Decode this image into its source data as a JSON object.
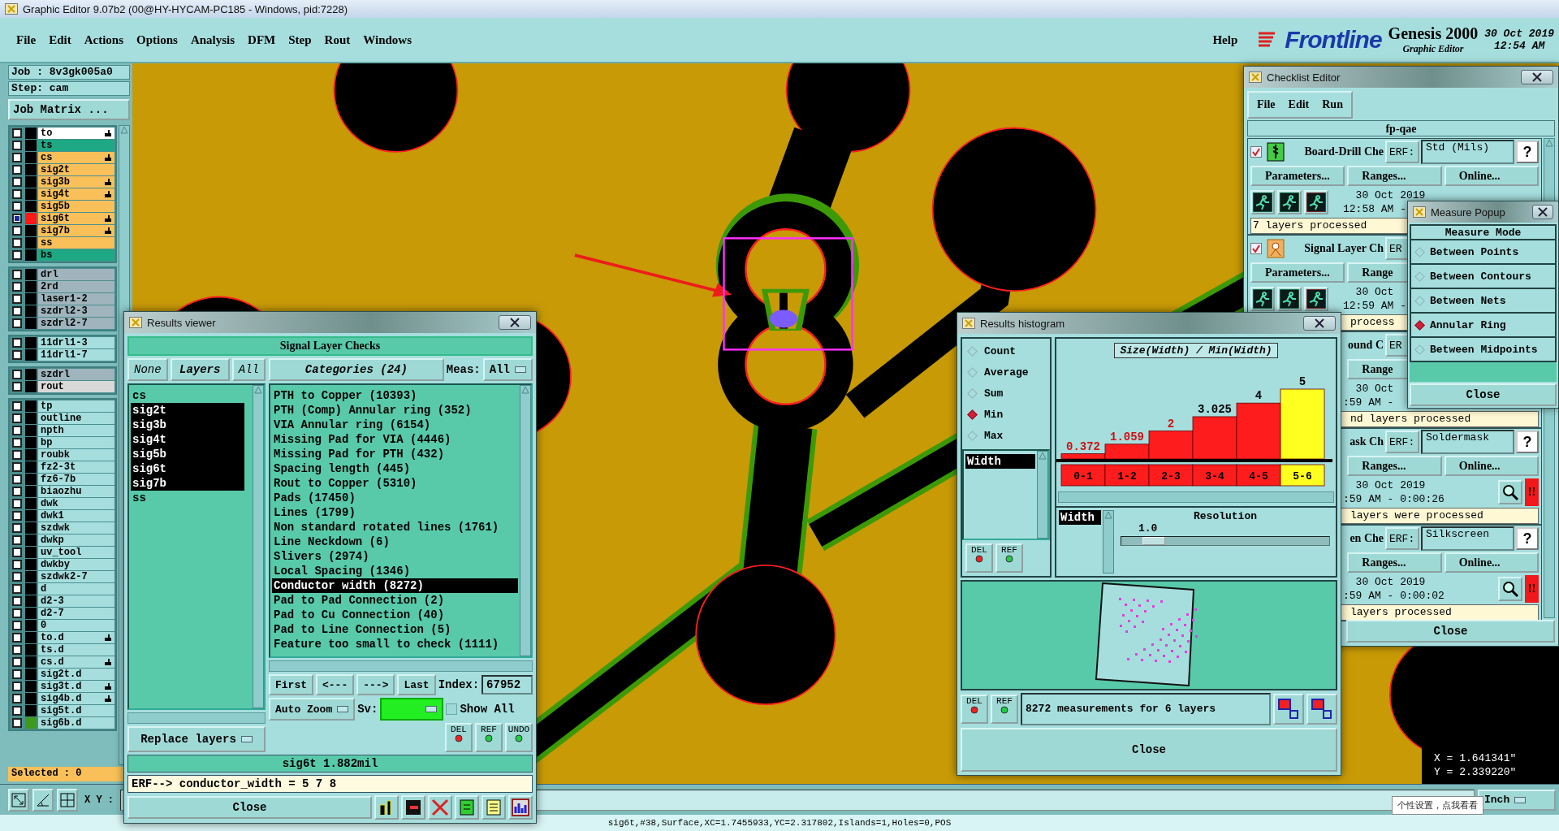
{
  "app": {
    "title": "Graphic Editor 9.07b2 (00@HY-HYCAM-PC185 - Windows, pid:7228)",
    "menu": [
      "File",
      "Edit",
      "Actions",
      "Options",
      "Analysis",
      "DFM",
      "Step",
      "Rout",
      "Windows"
    ],
    "help": "Help",
    "brand": {
      "logo": "Frontline",
      "product": "Genesis 2000",
      "subtitle": "Graphic Editor",
      "date": "30 Oct 2019",
      "time": "12:54 AM"
    }
  },
  "job_panel": {
    "job": "Job : 8v3gk005a0",
    "step": "Step: cam",
    "matrix_button": "Job Matrix ...",
    "layer_groups": [
      {
        "layers": [
          {
            "name": "to",
            "kind": "plain",
            "color": "#ffffff",
            "checked": false,
            "affected": true
          },
          {
            "name": "ts",
            "kind": "plain",
            "color": "#1ea884",
            "checked": false,
            "affected": false
          },
          {
            "name": "cs",
            "kind": "plain",
            "color": "#f9c05a",
            "checked": false,
            "affected": true
          },
          {
            "name": "sig2t",
            "kind": "plain",
            "color": "#f9c05a",
            "checked": false,
            "affected": false
          },
          {
            "name": "sig3b",
            "kind": "plain",
            "color": "#f9c05a",
            "checked": false,
            "affected": true
          },
          {
            "name": "sig4t",
            "kind": "plain",
            "color": "#f9c05a",
            "checked": false,
            "affected": true
          },
          {
            "name": "sig5b",
            "kind": "plain",
            "color": "#f9c05a",
            "checked": false,
            "affected": false
          },
          {
            "name": "sig6t",
            "kind": "work",
            "color": "#f9c05a",
            "checked": true,
            "affected": true
          },
          {
            "name": "sig7b",
            "kind": "plain",
            "color": "#f9c05a",
            "checked": false,
            "affected": true
          },
          {
            "name": "ss",
            "kind": "plain",
            "color": "#f9c05a",
            "checked": false,
            "affected": false
          },
          {
            "name": "bs",
            "kind": "plain",
            "color": "#1ea884",
            "checked": false,
            "affected": false
          }
        ]
      },
      {
        "layers": [
          {
            "name": "drl",
            "kind": "plain",
            "color": "#9fb4bc",
            "checked": false,
            "affected": false
          },
          {
            "name": "2rd",
            "kind": "plain",
            "color": "#9fb4bc",
            "checked": false,
            "affected": false
          },
          {
            "name": "laser1-2",
            "kind": "plain",
            "color": "#9fb4bc",
            "checked": false,
            "affected": false
          },
          {
            "name": "szdrl2-3",
            "kind": "plain",
            "color": "#9fb4bc",
            "checked": false,
            "affected": false
          },
          {
            "name": "szdrl2-7",
            "kind": "plain",
            "color": "#9fb4bc",
            "checked": false,
            "affected": false
          }
        ]
      },
      {
        "layers": [
          {
            "name": "11drl1-3",
            "kind": "plain",
            "color": "#a6dede",
            "checked": false,
            "affected": false
          },
          {
            "name": "11drl1-7",
            "kind": "plain",
            "color": "#a6dede",
            "checked": false,
            "affected": false
          }
        ]
      },
      {
        "layers": [
          {
            "name": "szdrl",
            "kind": "plain",
            "color": "#9fb4bc",
            "checked": false,
            "affected": false
          },
          {
            "name": "rout",
            "kind": "plain",
            "color": "#d9d9d9",
            "checked": false,
            "affected": false
          }
        ]
      },
      {
        "layers": [
          {
            "name": "tp",
            "kind": "plain",
            "color": "#a6dede",
            "checked": false,
            "affected": false
          },
          {
            "name": "outline",
            "kind": "plain",
            "color": "#a6dede",
            "checked": false,
            "affected": false
          },
          {
            "name": "npth",
            "kind": "plain",
            "color": "#a6dede",
            "checked": false,
            "affected": false
          },
          {
            "name": "bp",
            "kind": "plain",
            "color": "#a6dede",
            "checked": false,
            "affected": false
          },
          {
            "name": "roubk",
            "kind": "plain",
            "color": "#a6dede",
            "checked": false,
            "affected": false
          },
          {
            "name": "fz2-3t",
            "kind": "plain",
            "color": "#a6dede",
            "checked": false,
            "affected": false
          },
          {
            "name": "fz6-7b",
            "kind": "plain",
            "color": "#a6dede",
            "checked": false,
            "affected": false
          },
          {
            "name": "biaozhu",
            "kind": "plain",
            "color": "#a6dede",
            "checked": false,
            "affected": false
          },
          {
            "name": "dwk",
            "kind": "plain",
            "color": "#a6dede",
            "checked": false,
            "affected": false
          },
          {
            "name": "dwk1",
            "kind": "plain",
            "color": "#a6dede",
            "checked": false,
            "affected": false
          },
          {
            "name": "szdwk",
            "kind": "plain",
            "color": "#a6dede",
            "checked": false,
            "affected": false
          },
          {
            "name": "dwkp",
            "kind": "plain",
            "color": "#a6dede",
            "checked": false,
            "affected": false
          },
          {
            "name": "uv_tool",
            "kind": "plain",
            "color": "#a6dede",
            "checked": false,
            "affected": false
          },
          {
            "name": "dwkby",
            "kind": "plain",
            "color": "#a6dede",
            "checked": false,
            "affected": false
          },
          {
            "name": "szdwk2-7",
            "kind": "plain",
            "color": "#a6dede",
            "checked": false,
            "affected": false
          },
          {
            "name": "d",
            "kind": "plain",
            "color": "#a6dede",
            "checked": false,
            "affected": false
          },
          {
            "name": "d2-3",
            "kind": "plain",
            "color": "#a6dede",
            "checked": false,
            "affected": false
          },
          {
            "name": "d2-7",
            "kind": "plain",
            "color": "#a6dede",
            "checked": false,
            "affected": false
          },
          {
            "name": "0",
            "kind": "plain",
            "color": "#a6dede",
            "checked": false,
            "affected": false
          },
          {
            "name": "to.d",
            "kind": "plain",
            "color": "#a6dede",
            "checked": false,
            "affected": true
          },
          {
            "name": "ts.d",
            "kind": "plain",
            "color": "#a6dede",
            "checked": false,
            "affected": false
          },
          {
            "name": "cs.d",
            "kind": "plain",
            "color": "#a6dede",
            "checked": false,
            "affected": true
          },
          {
            "name": "sig2t.d",
            "kind": "plain",
            "color": "#a6dede",
            "checked": false,
            "affected": false
          },
          {
            "name": "sig3t.d",
            "kind": "plain",
            "color": "#a6dede",
            "checked": false,
            "affected": true
          },
          {
            "name": "sig4b.d",
            "kind": "plain",
            "color": "#a6dede",
            "checked": false,
            "affected": true
          },
          {
            "name": "sig5t.d",
            "kind": "plain",
            "color": "#a6dede",
            "checked": false,
            "affected": false
          },
          {
            "name": "sig6b.d",
            "kind": "displayed",
            "color": "#a6dede",
            "checked": false,
            "affected": false
          }
        ]
      }
    ],
    "selected": "Selected : 0"
  },
  "toolbar": {
    "xy_label": "X Y :",
    "units": "Inch"
  },
  "coordinates": {
    "x": "X = 1.641341\"",
    "y": "Y = 2.339220\""
  },
  "tooltip": "个性设置，点我看看",
  "status_bar": "sig6t,#38,Surface,XC=1.7455933,YC=2.317802,Islands=1,Holes=0,POS",
  "results_viewer": {
    "title": "Results viewer",
    "heading": "Signal Layer Checks",
    "layer_filters": [
      {
        "label": "None",
        "selected": false
      },
      {
        "label": "Layers",
        "selected": true
      },
      {
        "label": "All",
        "selected": false
      }
    ],
    "layers": [
      {
        "name": "cs",
        "selected": false
      },
      {
        "name": "sig2t",
        "selected": true
      },
      {
        "name": "sig3b",
        "selected": true
      },
      {
        "name": "sig4t",
        "selected": true
      },
      {
        "name": "sig5b",
        "selected": true
      },
      {
        "name": "sig6t",
        "selected": true
      },
      {
        "name": "sig7b",
        "selected": true
      },
      {
        "name": "ss",
        "selected": false
      }
    ],
    "categories_button": "Categories (24)",
    "meas_label": "Meas:",
    "meas_value": "All",
    "categories": [
      {
        "label": "PTH to Copper (10393)",
        "selected": false
      },
      {
        "label": "PTH (Comp) Annular ring (352)",
        "selected": false
      },
      {
        "label": "VIA Annular ring (6154)",
        "selected": false
      },
      {
        "label": "Missing Pad for VIA (4446)",
        "selected": false
      },
      {
        "label": "Missing Pad for PTH (432)",
        "selected": false
      },
      {
        "label": "Spacing length (445)",
        "selected": false
      },
      {
        "label": "Rout to Copper (5310)",
        "selected": false
      },
      {
        "label": "Pads (17450)",
        "selected": false
      },
      {
        "label": "Lines (1799)",
        "selected": false
      },
      {
        "label": "Non standard rotated lines (1761)",
        "selected": false
      },
      {
        "label": "Line Neckdown (6)",
        "selected": false
      },
      {
        "label": "Slivers (2974)",
        "selected": false
      },
      {
        "label": "Local Spacing (1346)",
        "selected": false
      },
      {
        "label": "Conductor width (8272)",
        "selected": true
      },
      {
        "label": "Pad to Pad Connection (2)",
        "selected": false
      },
      {
        "label": "Pad to Cu Connection (40)",
        "selected": false
      },
      {
        "label": "Pad to Line Connection (5)",
        "selected": false
      },
      {
        "label": "Feature too small to check (1111)",
        "selected": false
      }
    ],
    "nav": [
      "First",
      "<---",
      "--->",
      "Last"
    ],
    "index_label": "Index:",
    "index_value": "67952",
    "zoom_mode": "Auto Zoom",
    "sv": {
      "label": "Sv:",
      "color": "#22ee22"
    },
    "show_all": {
      "label": "Show All",
      "checked": false
    },
    "replace_mode": "Replace layers",
    "tools": [
      "DEL",
      "REF",
      "UNDO"
    ],
    "measurement": "sig6t 1.882mil",
    "erf": "ERF--> conductor_width = 5 7 8",
    "close": "Close"
  },
  "results_histogram": {
    "title": "Results histogram",
    "modes": [
      {
        "label": "Count",
        "selected": false
      },
      {
        "label": "Average",
        "selected": false
      },
      {
        "label": "Sum",
        "selected": false
      },
      {
        "label": "Min",
        "selected": true
      },
      {
        "label": "Max",
        "selected": false
      }
    ],
    "attributes": [
      {
        "label": "Width",
        "selected": true
      }
    ],
    "tools": [
      "DEL",
      "REF"
    ],
    "chart_title": "Size(Width) / Min(Width)",
    "chart_data": {
      "type": "bar",
      "categories": [
        "0-1",
        "1-2",
        "2-3",
        "3-4",
        "4-5",
        "5-6"
      ],
      "values": [
        0.372,
        1.059,
        2,
        3.025,
        4,
        5
      ],
      "data_labels": true
    },
    "bins": [
      {
        "selected": false
      },
      {
        "selected": false
      },
      {
        "selected": false
      },
      {
        "selected": false
      },
      {
        "selected": false
      },
      {
        "selected": true
      }
    ],
    "resolution_attribute": "Width",
    "resolution": {
      "label": "Resolution",
      "value": "1.0",
      "level": 0.1
    },
    "map_tools": [
      "DEL",
      "REF"
    ],
    "summary": "8272 measurements for 6 layers",
    "close": "Close"
  },
  "checklist_editor": {
    "title": "Checklist Editor",
    "menu": [
      "File",
      "Edit",
      "Run"
    ],
    "checklist": "fp-qae",
    "checks": [
      {
        "kind": "full",
        "checked": true,
        "name": "Board-Drill Che",
        "erf": "ERF:",
        "erf_value": "Std (Mils)",
        "help": "?",
        "buttons": [
          "Parameters...",
          "Ranges...",
          "Online..."
        ],
        "date": "30 Oct 2019",
        "time": "12:58 AM -",
        "status": "7 layers processed"
      },
      {
        "kind": "partly_covered",
        "checked": true,
        "name": "Signal Layer Ch",
        "erf": "ER",
        "buttons": [
          "Parameters...",
          "Range"
        ],
        "date": "30 Oct",
        "time": "12:59 AM -",
        "status": "process"
      },
      {
        "kind": "covered",
        "name": "ound C",
        "erf": "ER",
        "buttons": [
          "Range"
        ],
        "date": "30 Oct",
        "time": ":59 AM -",
        "status": "nd layers processed"
      },
      {
        "kind": "covered",
        "name": "ask Ch",
        "erf": "ERF:",
        "erf_value": "Soldermask",
        "help": "?",
        "buttons": [
          "Ranges...",
          "Online..."
        ],
        "date": "30 Oct 2019",
        "time": ":59 AM - 0:00:26",
        "alert": "!!",
        "status": "layers were processed"
      },
      {
        "kind": "covered",
        "name": "en Che",
        "erf": "ERF:",
        "erf_value": "Silkscreen",
        "help": "?",
        "buttons": [
          "Ranges...",
          "Online..."
        ],
        "date": "30 Oct 2019",
        "time": ":59 AM - 0:00:02",
        "alert": "!!",
        "status": "layers processed"
      }
    ],
    "close": "Close"
  },
  "measure_popup": {
    "title": "Measure Popup",
    "heading": "Measure Mode",
    "modes": [
      {
        "label": "Between Points",
        "selected": false
      },
      {
        "label": "Between Contours",
        "selected": false
      },
      {
        "label": "Between Nets",
        "selected": false
      },
      {
        "label": "Annular Ring",
        "selected": true
      },
      {
        "label": "Between Midpoints",
        "selected": false
      }
    ],
    "close": "Close"
  }
}
